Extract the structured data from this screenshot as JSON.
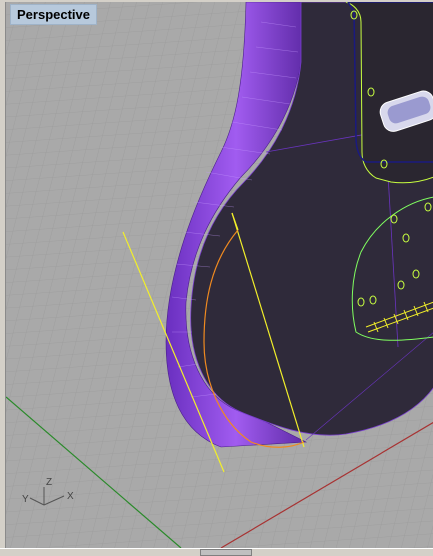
{
  "viewport": {
    "title": "Perspective",
    "axis_labels": {
      "x": "X",
      "y": "Y",
      "z": "Z"
    }
  },
  "colors": {
    "grid_bg": "#a9a9a9",
    "grid_line": "#9a9a9a",
    "grid_major": "#8c8c8c",
    "body_fill": "#2f2a3a",
    "edge_purple": "#8a3fdc",
    "curve_yellow": "#f2ef2a",
    "curve_orange": "#f08a20",
    "pickguard_green": "#c8ff40",
    "axis_red": "#a83232",
    "axis_green": "#2a8a2a",
    "title_bg": "#b7c9dc"
  },
  "icons": {
    "axis_widget": "xyz-axis-icon"
  }
}
